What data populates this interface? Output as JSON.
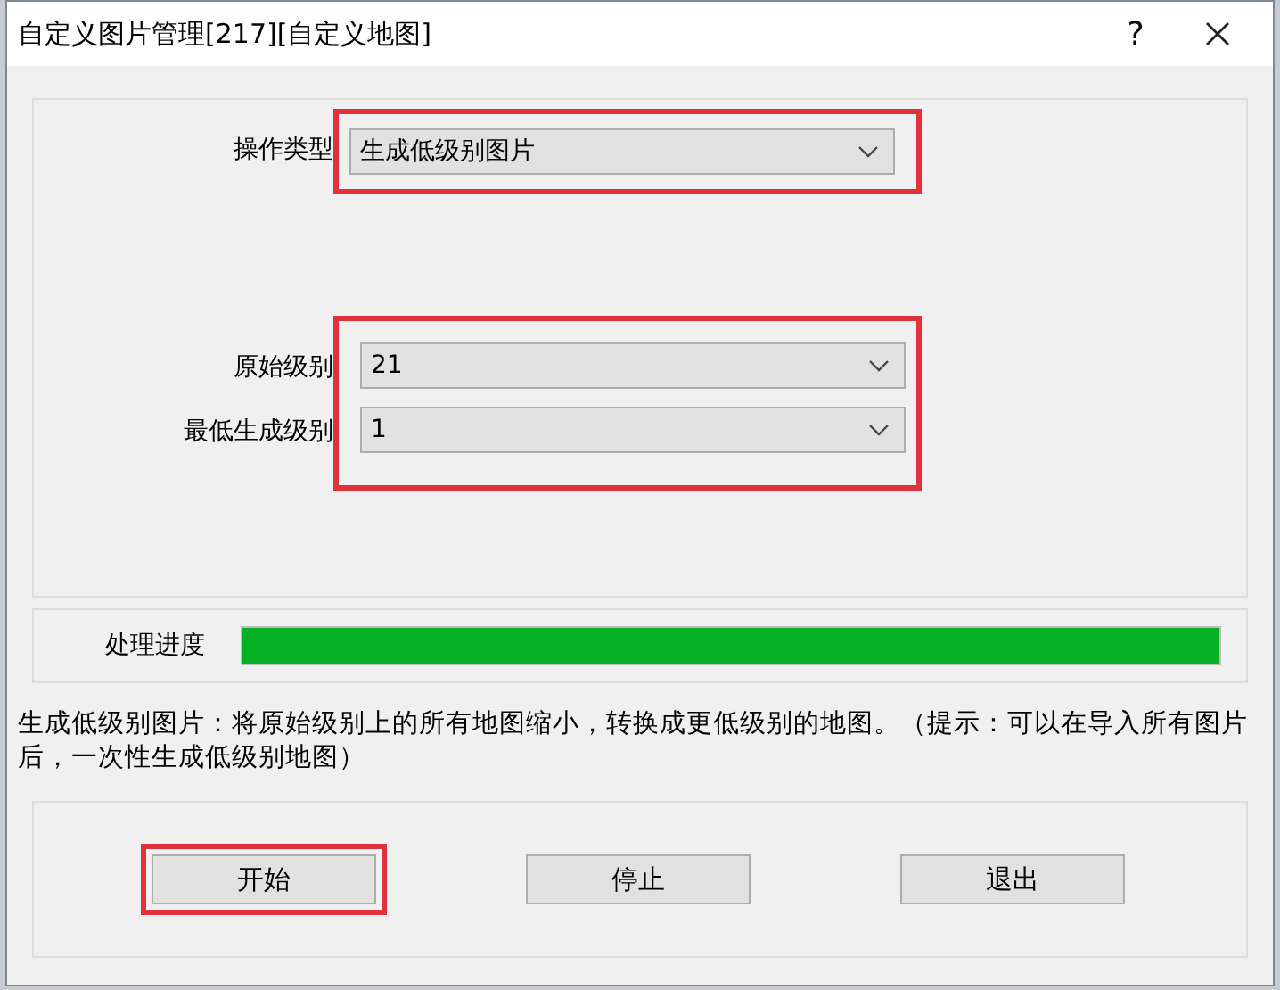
{
  "window": {
    "title": "自定义图片管理[217][自定义地图]",
    "help": "?"
  },
  "operation": {
    "highlighted": true,
    "fields": [
      {
        "label": "操作类型",
        "value": "生成低级别图片"
      }
    ]
  },
  "levels": {
    "highlighted": true,
    "fields": [
      {
        "label": "原始级别",
        "value": "21"
      },
      {
        "label": "最低生成级别",
        "value": "1"
      }
    ]
  },
  "progress": {
    "label": "处理进度",
    "level": 1
  },
  "description": "生成低级别图片：将原始级别上的所有地图缩小，转换成更低级别的地图。（提示：可以在导入所有图片后，一次性生成低级别地图）",
  "buttons": [
    {
      "label": "开始",
      "highlighted": true
    },
    {
      "label": "停止",
      "highlighted": false
    },
    {
      "label": "退出",
      "highlighted": false
    }
  ]
}
